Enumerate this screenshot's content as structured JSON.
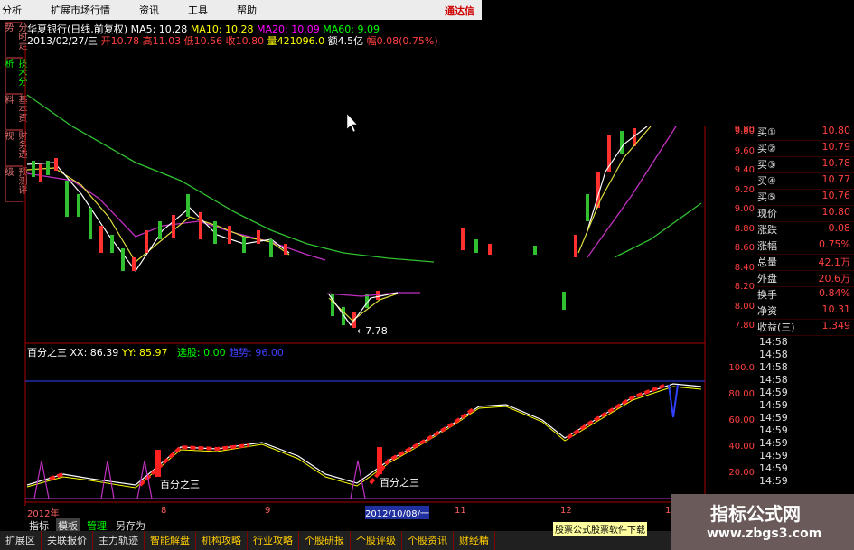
{
  "menu": [
    "分析",
    "扩展市场行情",
    "资讯",
    "工具",
    "帮助"
  ],
  "brand": "通达信",
  "side_tabs": [
    "分时走势",
    "技术分析",
    "基本资料",
    "财务透视",
    "预测评级"
  ],
  "info": {
    "title": "华夏银行(日线,前复权)",
    "ma5": "MA5: 10.28",
    "ma10": "MA10: 10.28",
    "ma20": "MA20: 10.09",
    "ma60": "MA60: 9.09",
    "date": "2013/02/27/三",
    "open": "开10.78",
    "high": "高11.03",
    "low": "低10.56",
    "close": "收10.80",
    "vol": "量421096.0",
    "amt": "额4.5亿",
    "chg": "幅0.08(0.75%)"
  },
  "low_label": "←7.78",
  "price_ticks": [
    "9.80",
    "9.60",
    "9.40",
    "9.20",
    "9.00",
    "8.80",
    "8.60",
    "8.40",
    "8.20",
    "8.00",
    "7.80"
  ],
  "osc_ticks": [
    "100.0",
    "80.00",
    "60.00",
    "40.00",
    "20.00"
  ],
  "panel_rows": [
    {
      "k": "买①",
      "v": "10.80"
    },
    {
      "k": "买②",
      "v": "10.79"
    },
    {
      "k": "买③",
      "v": "10.78"
    },
    {
      "k": "买④",
      "v": "10.77"
    },
    {
      "k": "买⑤",
      "v": "10.76"
    },
    {
      "k": "现价",
      "v": "10.80"
    },
    {
      "k": "涨跌",
      "v": "0.08"
    },
    {
      "k": "涨幅",
      "v": "0.75%"
    },
    {
      "k": "总量",
      "v": "42.1万"
    },
    {
      "k": "外盘",
      "v": "20.6万"
    },
    {
      "k": "换手",
      "v": "0.84%"
    },
    {
      "k": "净资",
      "v": "10.31"
    },
    {
      "k": "收益(三)",
      "v": "1.349"
    }
  ],
  "times": [
    "14:58",
    "14:58",
    "14:58",
    "14:58",
    "14:59",
    "14:59",
    "14:59",
    "14:59",
    "14:59",
    "14:59",
    "14:59",
    "14:59",
    "14:59",
    "14:59",
    "14:59"
  ],
  "sub": {
    "name": "百分之三",
    "xx": "XX: 86.39",
    "yy": "YY: 85.97",
    "sel": "选股: 0.00",
    "dir": "趋势: 96.00"
  },
  "marker_text": "百分之三",
  "axis_labels": [
    "2012年",
    "8",
    "9",
    "2012/10/08/一",
    "11",
    "12",
    "1"
  ],
  "tabs1": [
    "指标",
    "模板",
    "管理",
    "另存为"
  ],
  "tabs2": [
    "扩展区",
    "关联报价",
    "主力轨迹",
    "智能解盘",
    "机构攻略",
    "行业攻略",
    "个股研报",
    "个股评级",
    "个股资讯",
    "财经精"
  ],
  "tip": "股票公式股票软件下载",
  "ad": {
    "line1": "指标公式网",
    "line2": "www.zbgs3.com"
  }
}
